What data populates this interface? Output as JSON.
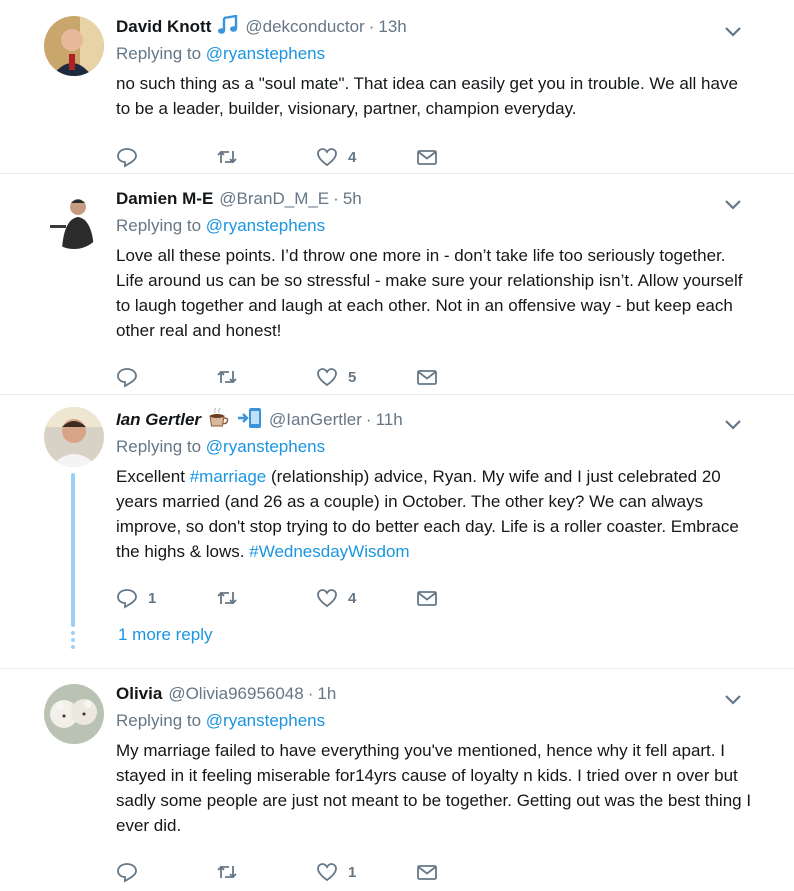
{
  "tweets": [
    {
      "name": "David Knott",
      "handle": "@dekconductor",
      "time": "13h",
      "badge": "music-note",
      "replying_prefix": "Replying to",
      "replying_to": "@ryanstephens",
      "text": "no such thing as a \"soul mate\".  That idea can easily get you in trouble.  We all have to be a leader, builder, visionary, partner, champion everyday.",
      "reply_count": "",
      "retweet_count": "",
      "like_count": "4"
    },
    {
      "name": "Damien M-E",
      "handle": "@BranD_M_E",
      "time": "5h",
      "replying_prefix": "Replying to",
      "replying_to": "@ryanstephens",
      "text": "Love all these points. I’d throw one more in - don’t take life too seriously together. Life around us can be so stressful - make sure your relationship isn’t. Allow yourself to laugh together and laugh at each other. Not in an offensive way - but keep each other real and honest!",
      "reply_count": "",
      "retweet_count": "",
      "like_count": "5"
    },
    {
      "name": "Ian Gertler",
      "handle": "@IanGertler",
      "time": "11h",
      "badges": [
        "coffee-emoji",
        "phone-arrow-emoji"
      ],
      "replying_prefix": "Replying to",
      "replying_to": "@ryanstephens",
      "text_parts": [
        {
          "text": "Excellent ",
          "type": "plain"
        },
        {
          "text": "#marriage",
          "type": "hashtag"
        },
        {
          "text": " (relationship) advice, Ryan. My wife and I just celebrated 20 years married (and 26 as a couple) in October. The other key? We can always improve, so don't stop trying to do better each day. Life is a roller coaster. Embrace the highs & lows. ",
          "type": "plain"
        },
        {
          "text": "#WednesdayWisdom",
          "type": "hashtag"
        }
      ],
      "reply_count": "1",
      "retweet_count": "",
      "like_count": "4"
    },
    {
      "name": "Olivia",
      "handle": "@Olivia96956048",
      "time": "1h",
      "replying_prefix": "Replying to",
      "replying_to": "@ryanstephens",
      "text": "My marriage failed to have everything you've mentioned, hence why it fell apart. I stayed in it feeling miserable for14yrs cause of loyalty n kids. I tried over n over but sadly some people are just not meant to be together. Getting out was the best thing I ever did.",
      "reply_count": "",
      "retweet_count": "",
      "like_count": "1"
    }
  ],
  "more_replies": "1 more reply",
  "separator": "·",
  "colors": {
    "link": "#1b95e0",
    "muted": "#657786",
    "thread": "#9ad0f5",
    "border": "#e6ecf0"
  }
}
